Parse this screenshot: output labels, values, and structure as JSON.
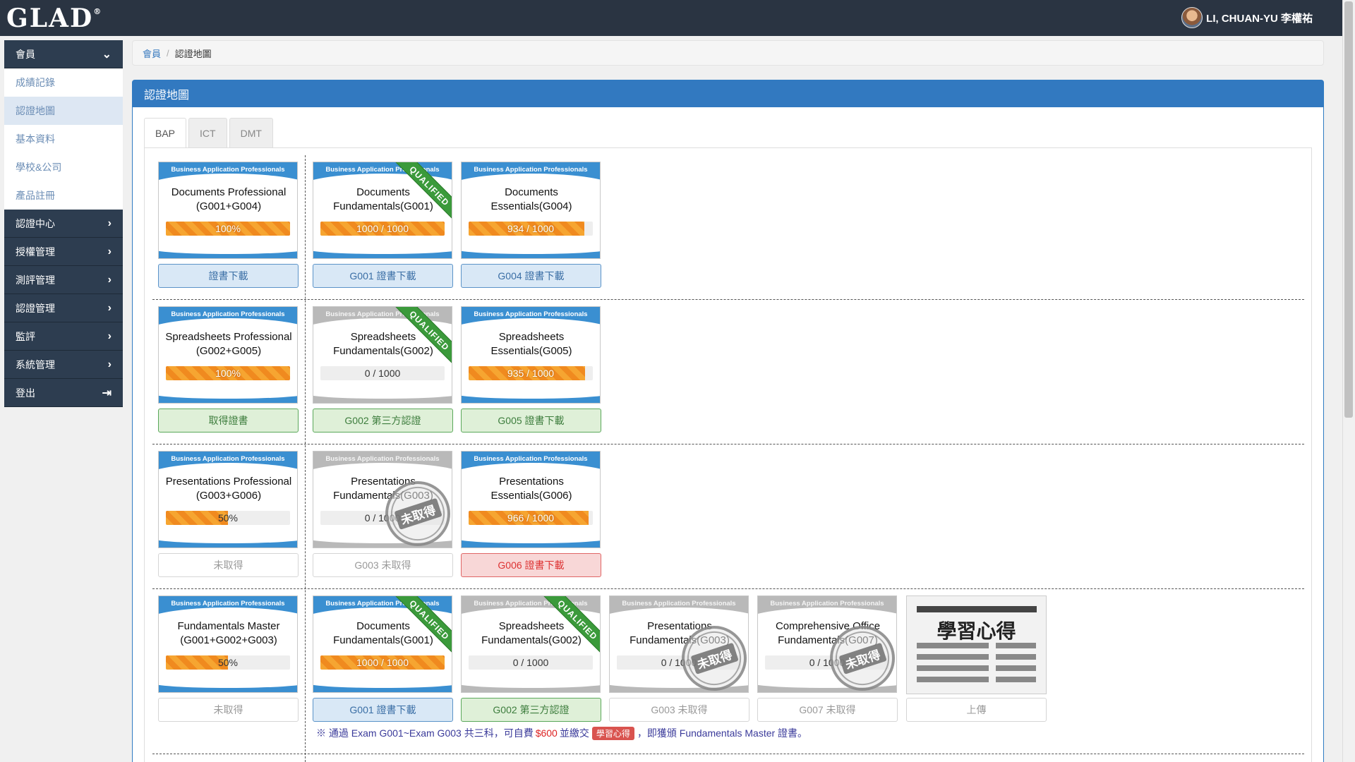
{
  "header": {
    "logo_text": "GLAD",
    "logo_mark": "®",
    "user_name": "LI, CHUAN-YU 李權祐"
  },
  "sidebar": {
    "member_label": "會員",
    "sub_items": [
      "成績記錄",
      "認證地圖",
      "基本資料",
      "學校&公司",
      "產品註冊"
    ],
    "items": [
      "認證中心",
      "授權管理",
      "測評管理",
      "認證管理",
      "監評",
      "系統管理",
      "登出"
    ]
  },
  "breadcrumb": {
    "home": "會員",
    "current": "認證地圖"
  },
  "panel": {
    "title": "認證地圖"
  },
  "tabs": [
    "BAP",
    "ICT",
    "DMT"
  ],
  "brand": "Business Application Professionals",
  "qualified_label": "QUALIFIED",
  "stamp_label": "未取得",
  "rows": [
    {
      "cards": [
        {
          "title1": "Documents Professional",
          "title2": "(G001+G004)",
          "progress": "100%",
          "fill": 1.0,
          "style": "blue",
          "qualified": false,
          "stamp": false
        },
        {
          "title1": "Documents",
          "title2": "Fundamentals(G001)",
          "progress": "1000 / 1000",
          "fill": 1.0,
          "style": "blue",
          "qualified": true,
          "stamp": false
        },
        {
          "title1": "Documents",
          "title2": "Essentials(G004)",
          "progress": "934 / 1000",
          "fill": 0.934,
          "style": "blue",
          "qualified": false,
          "stamp": false
        }
      ],
      "buttons": [
        {
          "label": "證書下載",
          "style": "blue"
        },
        {
          "label": "G001 證書下載",
          "style": "blue"
        },
        {
          "label": "G004 證書下載",
          "style": "blue"
        }
      ]
    },
    {
      "cards": [
        {
          "title1": "Spreadsheets Professional",
          "title2": "(G002+G005)",
          "progress": "100%",
          "fill": 1.0,
          "style": "blue",
          "qualified": false,
          "stamp": false
        },
        {
          "title1": "Spreadsheets",
          "title2": "Fundamentals(G002)",
          "progress": "0 / 1000",
          "fill": 0,
          "style": "grey",
          "qualified": true,
          "stamp": false
        },
        {
          "title1": "Spreadsheets",
          "title2": "Essentials(G005)",
          "progress": "935 / 1000",
          "fill": 0.935,
          "style": "blue",
          "qualified": false,
          "stamp": false
        }
      ],
      "buttons": [
        {
          "label": "取得證書",
          "style": "green"
        },
        {
          "label": "G002 第三方認證",
          "style": "green"
        },
        {
          "label": "G005 證書下載",
          "style": "green"
        }
      ]
    },
    {
      "cards": [
        {
          "title1": "Presentations Professional",
          "title2": "(G003+G006)",
          "progress": "50%",
          "fill": 0.5,
          "style": "blue",
          "qualified": false,
          "stamp": false
        },
        {
          "title1": "Presentations",
          "title2": "Fundamentals(G003)",
          "progress": "0 / 1000",
          "fill": 0,
          "style": "grey",
          "qualified": false,
          "stamp": true
        },
        {
          "title1": "Presentations",
          "title2": "Essentials(G006)",
          "progress": "966 / 1000",
          "fill": 0.966,
          "style": "blue",
          "qualified": false,
          "stamp": false
        }
      ],
      "buttons": [
        {
          "label": "未取得",
          "style": "plain"
        },
        {
          "label": "G003 未取得",
          "style": "plain"
        },
        {
          "label": "G006 證書下載",
          "style": "red"
        }
      ]
    },
    {
      "cards": [
        {
          "title1": "Fundamentals Master",
          "title2": "(G001+G002+G003)",
          "progress": "50%",
          "fill": 0.5,
          "style": "blue",
          "qualified": false,
          "stamp": false
        },
        {
          "title1": "Documents",
          "title2": "Fundamentals(G001)",
          "progress": "1000 / 1000",
          "fill": 1.0,
          "style": "blue",
          "qualified": true,
          "stamp": false
        },
        {
          "title1": "Spreadsheets",
          "title2": "Fundamentals(G002)",
          "progress": "0 / 1000",
          "fill": 0,
          "style": "grey",
          "qualified": true,
          "stamp": false
        },
        {
          "title1": "Presentations",
          "title2": "Fundamentals(G003)",
          "progress": "0 / 1000",
          "fill": 0,
          "style": "grey",
          "qualified": false,
          "stamp": true
        },
        {
          "title1": "Comprehensive Office",
          "title2": "Fundamentals(G007)",
          "progress": "0 / 1000",
          "fill": 0,
          "style": "grey",
          "qualified": false,
          "stamp": true
        }
      ],
      "buttons": [
        {
          "label": "未取得",
          "style": "plain"
        },
        {
          "label": "G001 證書下載",
          "style": "blue"
        },
        {
          "label": "G002 第三方認證",
          "style": "green"
        },
        {
          "label": "G003 未取得",
          "style": "plain"
        },
        {
          "label": "G007 未取得",
          "style": "plain"
        },
        {
          "label": "上傳",
          "style": "plain"
        }
      ]
    }
  ],
  "study_notes": {
    "title": "學習心得"
  },
  "footnote": {
    "prefix": "※ 通過 Exam G001~Exam G003 共三科，可自費",
    "price": "$600",
    "mid": "並繳交",
    "badge": "學習心得",
    "suffix": "，即獲頒 Fundamentals Master 證書。"
  }
}
